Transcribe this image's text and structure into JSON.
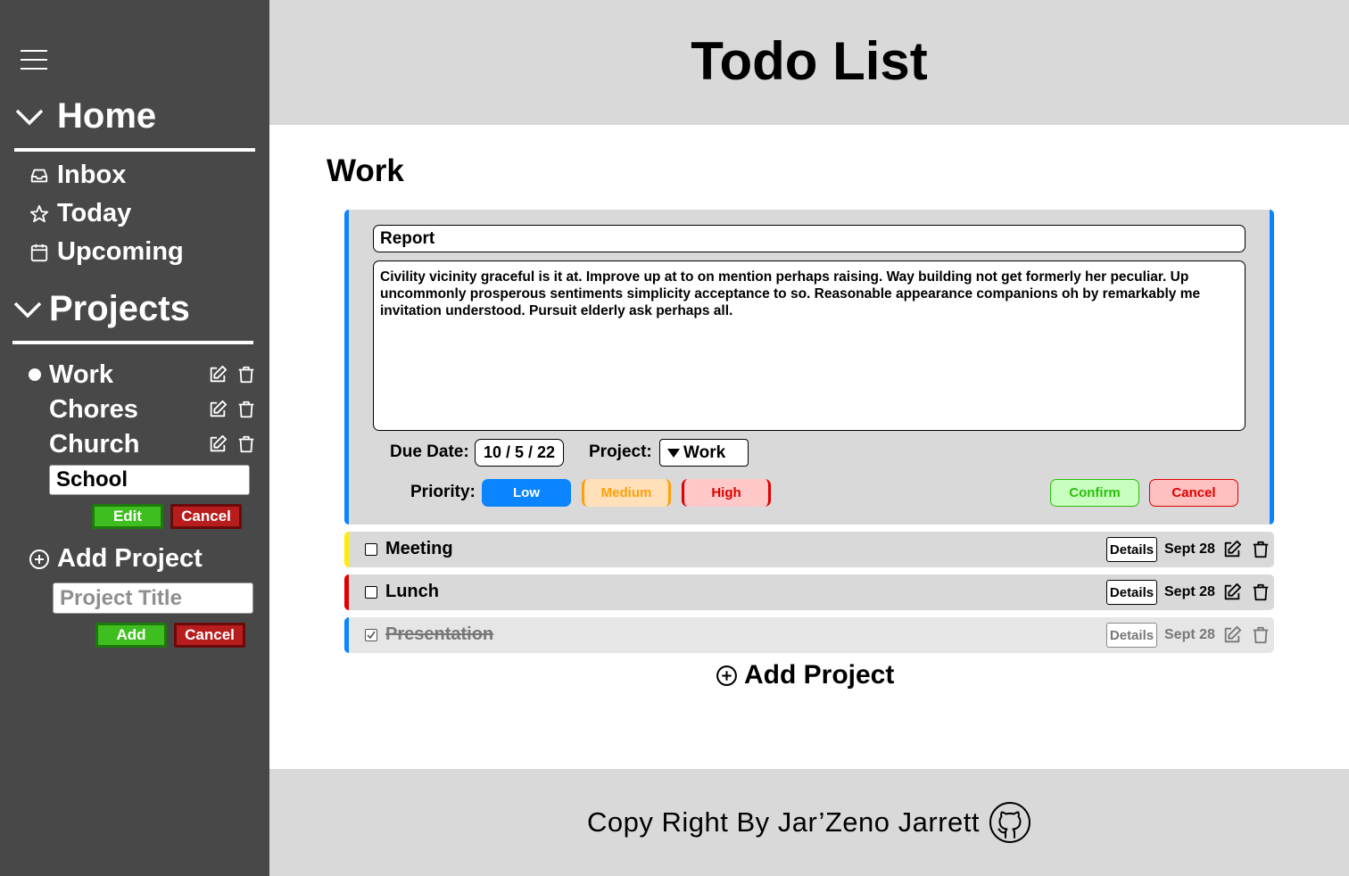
{
  "app": {
    "title": "Todo List"
  },
  "sidebar": {
    "home": {
      "label": "Home",
      "items": [
        {
          "label": "Inbox",
          "icon": "inbox-icon"
        },
        {
          "label": "Today",
          "icon": "star-icon"
        },
        {
          "label": "Upcoming",
          "icon": "calendar-icon"
        }
      ]
    },
    "projects": {
      "label": "Projects",
      "items": [
        {
          "label": "Work",
          "active": true
        },
        {
          "label": "Chores",
          "active": false
        },
        {
          "label": "Church",
          "active": false
        }
      ],
      "edit_input_value": "School",
      "edit_button": "Edit",
      "edit_cancel_button": "Cancel"
    },
    "add_project": {
      "label": "Add Project",
      "placeholder": "Project Title",
      "add_button": "Add",
      "cancel_button": "Cancel"
    }
  },
  "main": {
    "project_title": "Work",
    "edit_task": {
      "title_value": "Report",
      "description": "Civility vicinity graceful is it at. Improve up at to on mention perhaps raising. Way building not get formerly her peculiar. Up uncommonly prosperous sentiments simplicity acceptance to so. Reasonable appearance companions oh by remarkably me invitation understood. Pursuit elderly ask perhaps all.",
      "due_date_label": "Due Date:",
      "due_date_value": "10 / 5 / 22",
      "project_label": "Project:",
      "project_value": "Work",
      "priority_label": "Priority:",
      "priority_low": "Low",
      "priority_medium": "Medium",
      "priority_high": "High",
      "selected_priority": "Low",
      "confirm_button": "Confirm",
      "cancel_button": "Cancel",
      "accent_color": "#0a84ff"
    },
    "tasks": [
      {
        "name": "Meeting",
        "details": "Details",
        "date": "Sept 28",
        "done": false,
        "color": "#ffeb0a"
      },
      {
        "name": "Lunch",
        "details": "Details",
        "date": "Sept 28",
        "done": false,
        "color": "#e00000"
      },
      {
        "name": "Presentation",
        "details": "Details",
        "date": "Sept 28",
        "done": true,
        "color": "#0a84ff"
      }
    ],
    "add_project_label": "Add Project"
  },
  "footer": {
    "text": "Copy Right By Jar’Zeno Jarrett",
    "icon": "github-icon"
  }
}
